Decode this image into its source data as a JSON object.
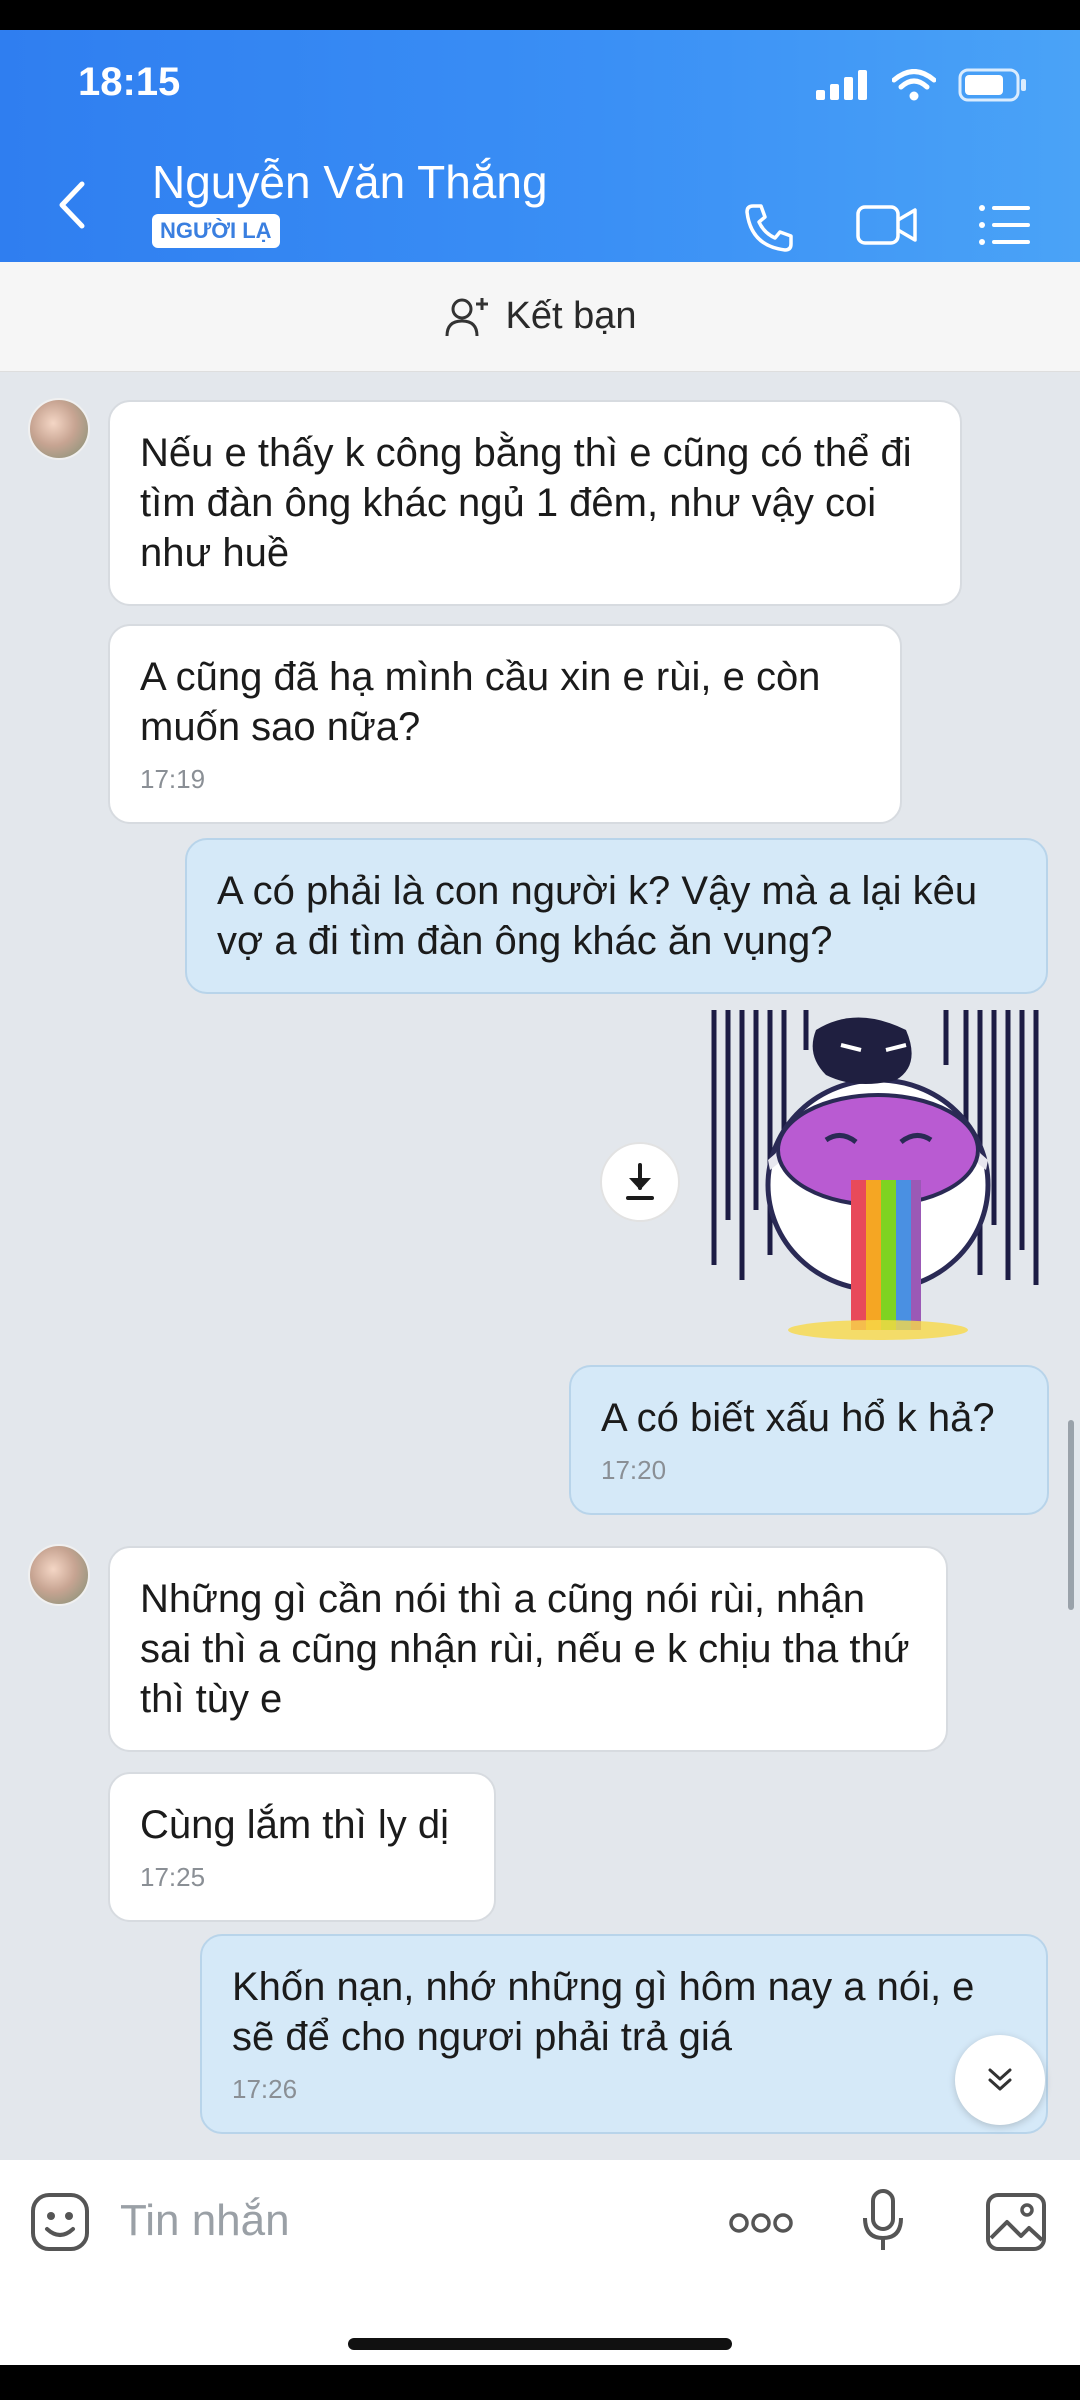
{
  "status": {
    "time": "18:15"
  },
  "header": {
    "name": "Nguyễn Văn Thắng",
    "badge": "NGƯỜI LẠ",
    "accent": "#3a8ff5"
  },
  "friend_bar": {
    "label": "Kết bạn"
  },
  "messages": [
    {
      "side": "in",
      "text": "Nếu e thấy k công bằng thì e cũng có thể đi tìm đàn ông khác ngủ 1 đêm, như vậy coi như huề",
      "time": ""
    },
    {
      "side": "in",
      "text": "A cũng đã hạ mình cầu xin e rùi, e còn muốn sao nữa?",
      "time": "17:19"
    },
    {
      "side": "out",
      "text": "A có phải là con người k? Vậy mà a lại kêu vợ a đi tìm đàn ông khác ăn vụng?",
      "time": ""
    },
    {
      "side": "out",
      "text": "A có biết xấu hổ k hả?",
      "time": "17:20"
    },
    {
      "side": "in",
      "text": "Những gì cần nói thì a cũng nói rùi, nhận sai thì a cũng nhận rùi, nếu e k chịu tha thứ thì tùy e",
      "time": ""
    },
    {
      "side": "in",
      "text": "Cùng lắm thì ly dị",
      "time": "17:25"
    },
    {
      "side": "out",
      "text": "Khốn nạn, nhớ những gì hôm nay a nói, e sẽ để cho ngươi phải trả giá",
      "time": "17:26"
    }
  ],
  "composer": {
    "placeholder": "Tin nhắn"
  },
  "colors": {
    "outgoing_bubble": "#d5e9f8",
    "incoming_bubble": "#ffffff",
    "chat_bg": "#e3e7ec"
  }
}
